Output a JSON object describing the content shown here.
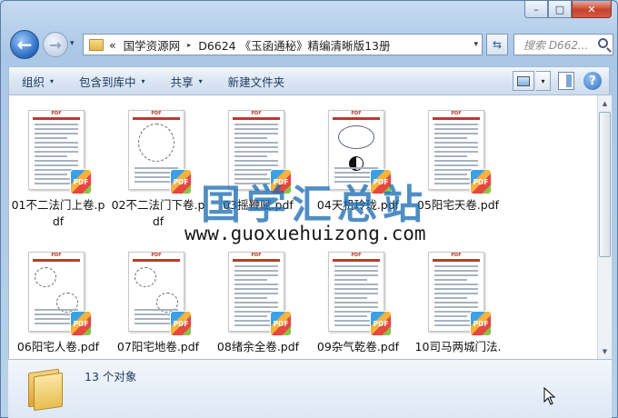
{
  "window": {
    "caption": {
      "minimize": "–",
      "maximize": "□",
      "close": "✕"
    }
  },
  "nav": {
    "back_glyph": "←",
    "forward_glyph": "→",
    "dropdown_glyph": "▾",
    "overflow": "«",
    "breadcrumb": [
      "国学资源网",
      "D6624 《玉函通秘》精编清晰版13册"
    ],
    "separator": "▸",
    "address_dropdown": "▾",
    "refresh_glyph": "⇆",
    "search_placeholder": "搜索 D662..."
  },
  "toolbar": {
    "organize": "组织",
    "include_in_library": "包含到库中",
    "share": "共享",
    "new_folder": "新建文件夹",
    "dropdown_glyph": "▾",
    "help": "?"
  },
  "files": [
    {
      "name": "01不二法门上卷.pdf",
      "thumb": "text"
    },
    {
      "name": "02不二法门下卷.pdf",
      "thumb": "diagram"
    },
    {
      "name": "03摇鞭赋.pdf",
      "thumb": "text"
    },
    {
      "name": "04天机玲珑.pdf",
      "thumb": "yinyang"
    },
    {
      "name": "05阳宅天卷.pdf",
      "thumb": "text"
    },
    {
      "name": "06阳宅人卷.pdf",
      "thumb": "figures"
    },
    {
      "name": "07阳宅地卷.pdf",
      "thumb": "figures"
    },
    {
      "name": "08绪余全卷.pdf",
      "thumb": "text"
    },
    {
      "name": "09杂气乾卷.pdf",
      "thumb": "text"
    },
    {
      "name": "10司马两城门法.",
      "thumb": "text"
    }
  ],
  "thumb_badge": "PDF",
  "thumb_page_header": "PDF",
  "watermark": {
    "title": "国学汇总站",
    "url": "www.guoxuehuizong.com"
  },
  "status": {
    "count": "13 个对象"
  },
  "colors": {
    "accent": "#2c6fc4",
    "pdf_red": "#c0392b"
  }
}
